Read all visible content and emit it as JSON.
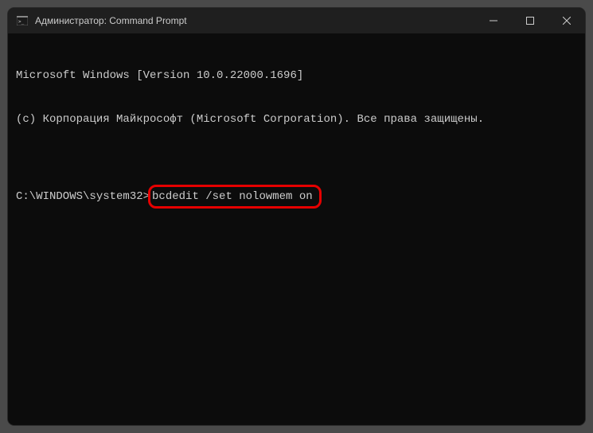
{
  "titlebar": {
    "title": "Администратор: Command Prompt"
  },
  "terminal": {
    "line1": "Microsoft Windows [Version 10.0.22000.1696]",
    "line2": "(c) Корпорация Майкрософт (Microsoft Corporation). Все права защищены.",
    "blank": "",
    "prompt": "C:\\WINDOWS\\system32>",
    "command": "bcdedit /set nolowmem on"
  },
  "highlight": {
    "color": "#e60000"
  }
}
